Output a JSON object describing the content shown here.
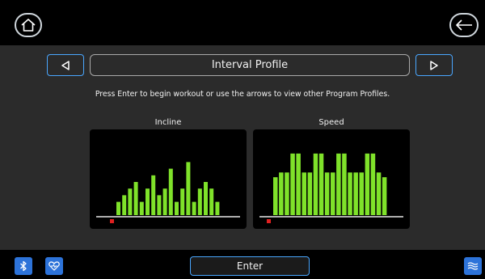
{
  "header": {
    "home_icon": "home-icon",
    "back_icon": "back-arrow-icon"
  },
  "nav": {
    "prev_icon": "triangle-left-icon",
    "next_icon": "triangle-right-icon",
    "title": "Interval Profile"
  },
  "instruction": "Press Enter to begin workout or use the arrows to view other Program Profiles.",
  "charts": {
    "incline_label": "Incline",
    "speed_label": "Speed"
  },
  "footer": {
    "bluetooth_icon": "bluetooth-icon",
    "heart_icon": "heart-icon",
    "enter_label": "Enter",
    "waves_icon": "waves-icon"
  },
  "colors": {
    "bar": "#7fe22a",
    "marker": "#e02020",
    "accent": "#4aa7ff",
    "button": "#2d73d9"
  },
  "chart_data": [
    {
      "type": "bar",
      "name": "Incline",
      "values": [
        2,
        3,
        4,
        5,
        2,
        4,
        6,
        3,
        4,
        7,
        2,
        4,
        8,
        2,
        4,
        5,
        4,
        2
      ],
      "ylim": [
        0,
        10
      ],
      "marker_index": 0
    },
    {
      "type": "bar",
      "name": "Speed",
      "values": [
        8,
        9,
        9,
        13,
        13,
        9,
        9,
        13,
        13,
        9,
        9,
        13,
        13,
        9,
        9,
        9,
        13,
        13,
        9,
        8
      ],
      "ylim": [
        0,
        14
      ],
      "marker_index": 0
    }
  ]
}
